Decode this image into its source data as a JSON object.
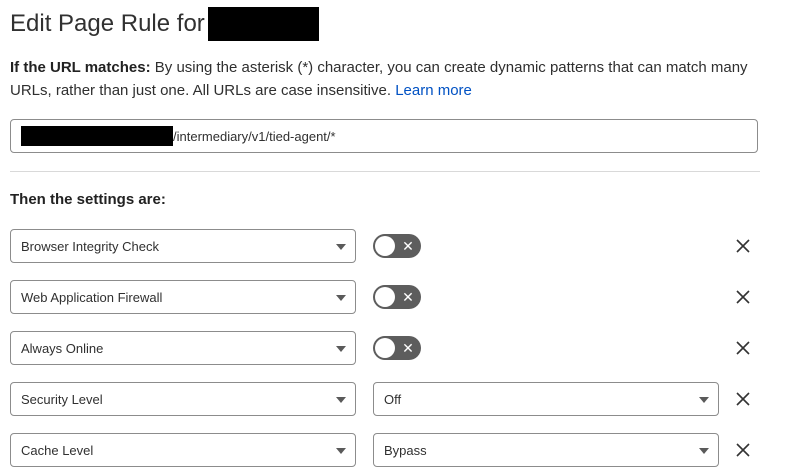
{
  "header": {
    "title": "Edit Page Rule for"
  },
  "description": {
    "label": "If the URL matches:",
    "text": "By using the asterisk (*) character, you can create dynamic patterns that can match many URLs, rather than just one. All URLs are case insensitive.",
    "link": "Learn more"
  },
  "url_field": {
    "value_suffix": "/intermediary/v1/tied-agent/*"
  },
  "settings": {
    "heading": "Then the settings are:",
    "rows": [
      {
        "setting": "Browser Integrity Check",
        "control": "toggle",
        "state": "off"
      },
      {
        "setting": "Web Application Firewall",
        "control": "toggle",
        "state": "off"
      },
      {
        "setting": "Always Online",
        "control": "toggle",
        "state": "off"
      },
      {
        "setting": "Security Level",
        "control": "select",
        "value": "Off"
      },
      {
        "setting": "Cache Level",
        "control": "select",
        "value": "Bypass"
      }
    ]
  },
  "icons": {
    "toggle_off": "x-icon",
    "remove": "close-icon",
    "dropdown": "chevron-down-icon"
  },
  "colors": {
    "link": "#0051c3",
    "toggle_off_bg": "#5d5d5d",
    "border": "#8c8c8c"
  }
}
